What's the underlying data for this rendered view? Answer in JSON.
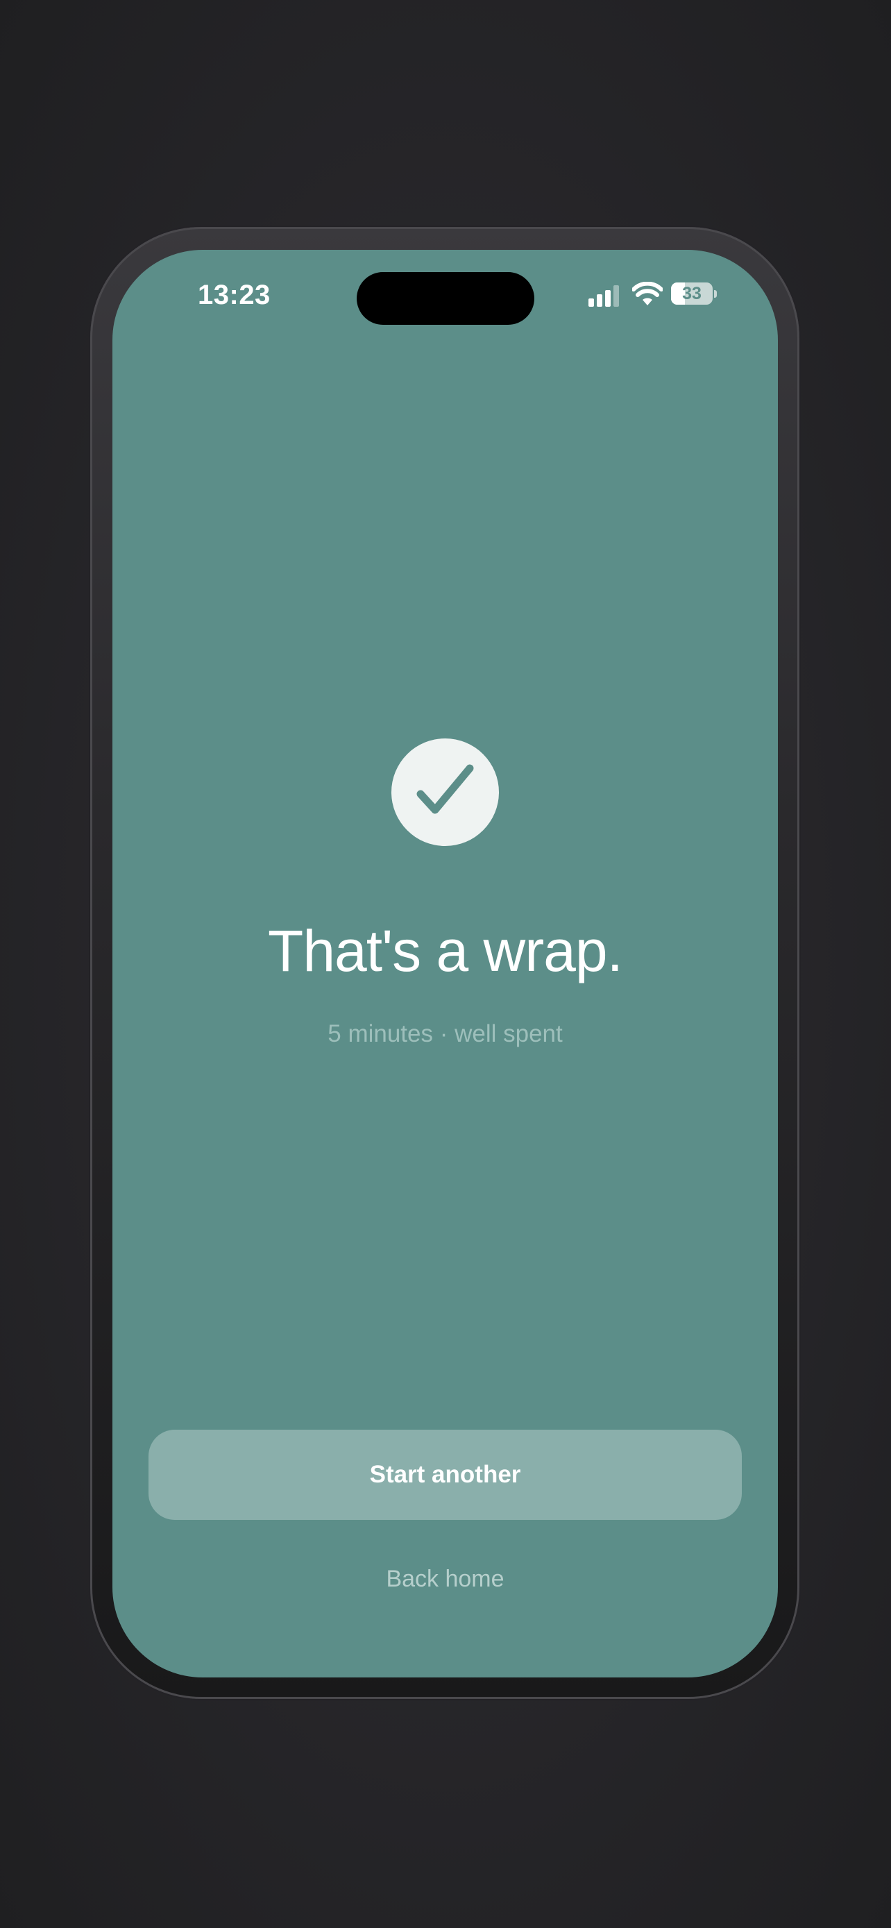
{
  "status_bar": {
    "time": "13:23",
    "battery_percent": "33",
    "battery_level": 0.33,
    "signal_icon": "cellular-signal-icon",
    "wifi_icon": "wifi-icon"
  },
  "completion": {
    "icon": "checkmark-circle-icon",
    "title": "That's a wrap.",
    "subtitle": "5 minutes · well spent"
  },
  "actions": {
    "primary_label": "Start another",
    "secondary_label": "Back home"
  },
  "colors": {
    "screen_background": "#5c8e89",
    "check_badge": "#eff3f2",
    "check_mark": "#5c8e89",
    "primary_button": "#8aafab",
    "subtitle_text": "#9dbfbb"
  }
}
